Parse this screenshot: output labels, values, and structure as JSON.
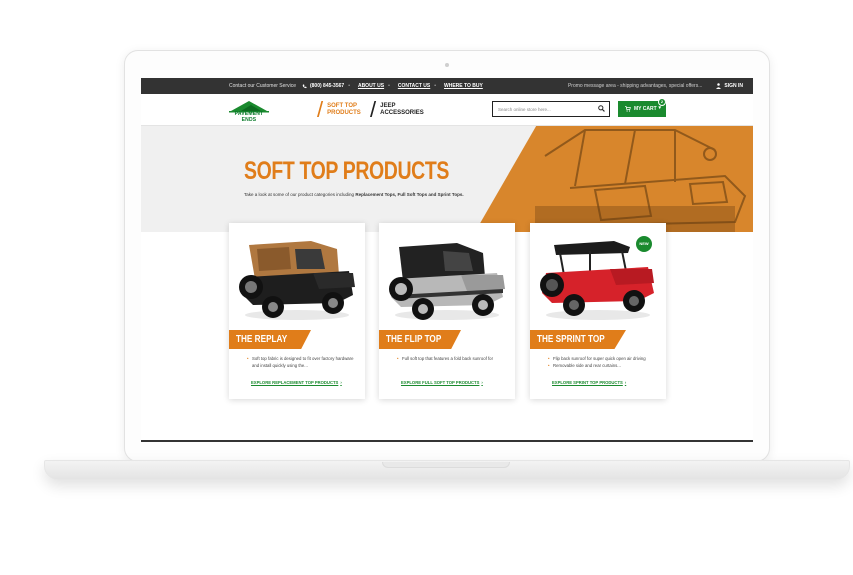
{
  "topbar": {
    "contact": "Contact our Customer Service",
    "phone": "(800) 845-3567",
    "links": [
      "ABOUT US",
      "CONTACT US",
      "WHERE TO BUY"
    ],
    "promo": "Promo message area - shipping advantages, special offers...",
    "signin": "SIGN IN"
  },
  "header": {
    "logo_text": "PAVEMENT ENDS",
    "nav": [
      {
        "line1": "SOFT TOP",
        "line2": "PRODUCTS"
      },
      {
        "line1": "JEEP",
        "line2": "ACCESSORIES"
      }
    ],
    "search_placeholder": "Search online store here...",
    "cart_label": "MY CART",
    "cart_count": "2"
  },
  "hero": {
    "title": "SOFT TOP PRODUCTS",
    "desc_prefix": "Take a look at some of our product categories including ",
    "desc_bold": "Replacement Tops, Full Soft Tops and Sprint Tops."
  },
  "cards": [
    {
      "title": "THE REPLAY",
      "bullets": [
        "Soft top fabric is designed to fit over factory hardware and install quickly using the..."
      ],
      "link": "EXPLORE REPLACEMENT TOP PRODUCTS"
    },
    {
      "title": "THE FLIP TOP",
      "bullets": [
        "Full soft top that features a fold back sunroof for"
      ],
      "link": "EXPLORE FULL SOFT TOP PRODUCTS"
    },
    {
      "title": "THE SPRINT TOP",
      "badge": "NEW",
      "bullets": [
        "Flip back sunroof for super quick open air driving",
        "Removable side and rear curtains..."
      ],
      "link": "EXPLORE SPRINT TOP PRODUCTS"
    }
  ],
  "colors": {
    "accent_orange": "#e07d1a",
    "brand_green": "#1a8a2e",
    "topbar_dark": "#333333"
  }
}
